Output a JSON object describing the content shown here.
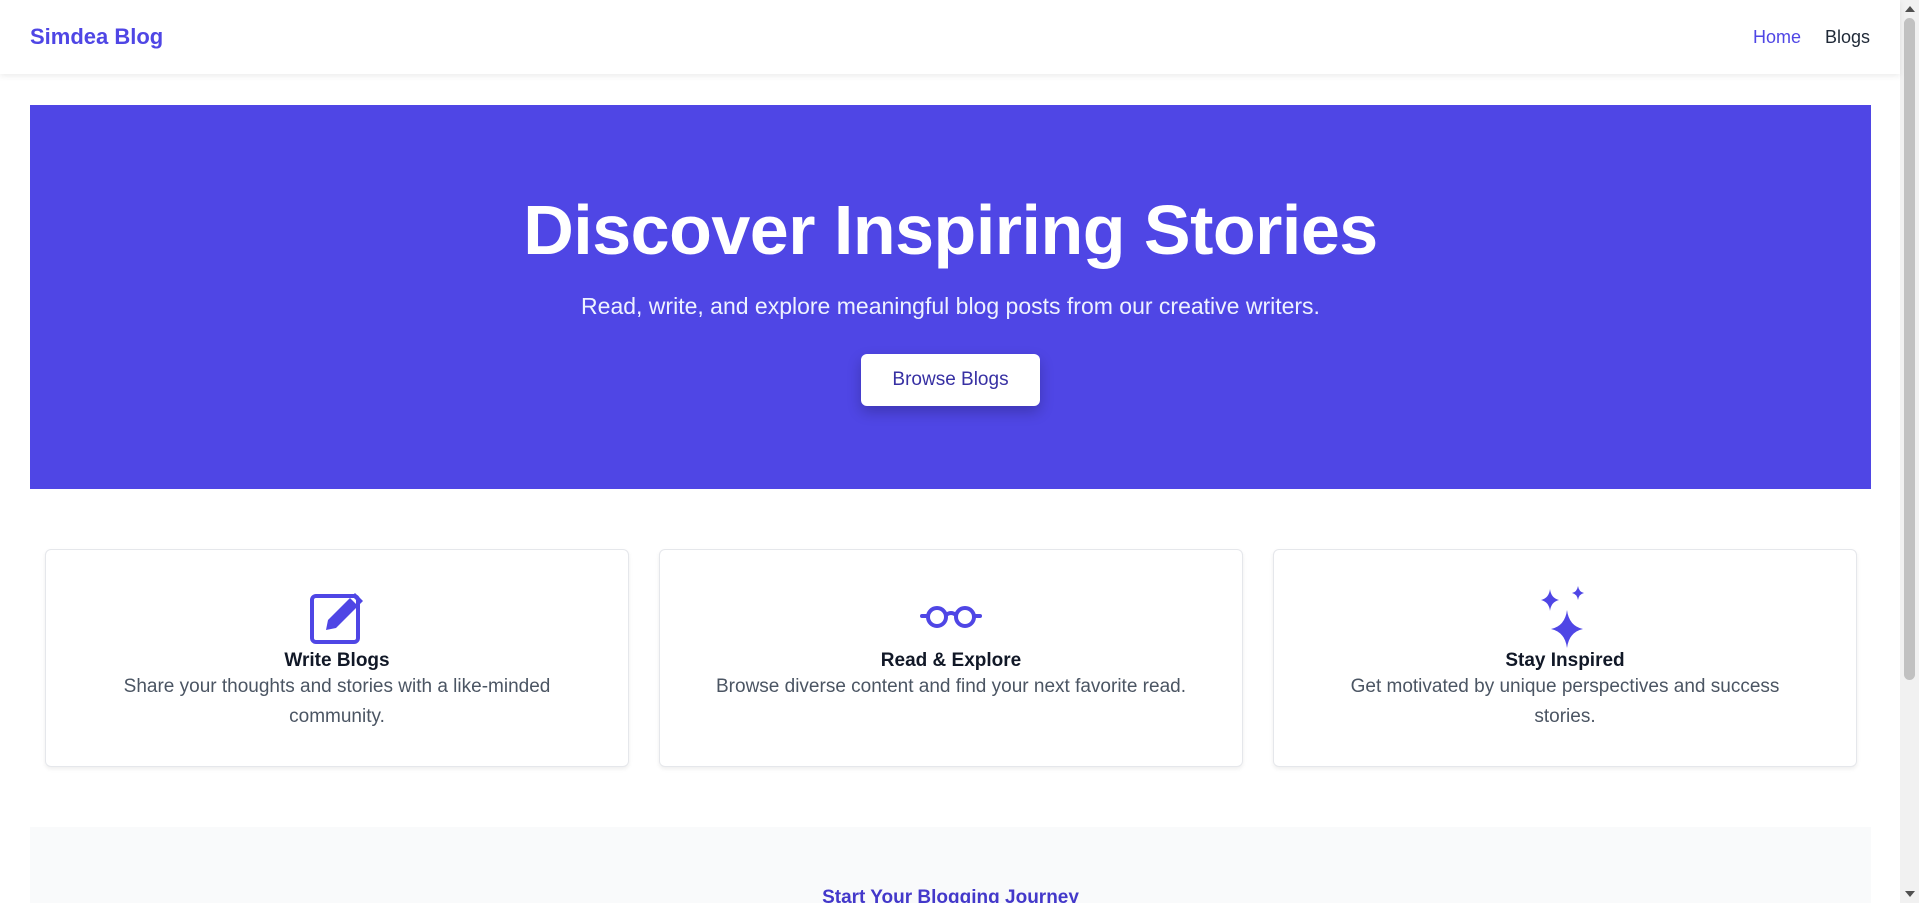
{
  "navbar": {
    "brand": "Simdea Blog",
    "links": [
      {
        "label": "Home",
        "active": true
      },
      {
        "label": "Blogs",
        "active": false
      }
    ]
  },
  "hero": {
    "title": "Discover Inspiring Stories",
    "subtitle": "Read, write, and explore meaningful blog posts from our creative writers.",
    "button_label": "Browse Blogs"
  },
  "features": [
    {
      "icon": "pencil-square-icon",
      "title": "Write Blogs",
      "description": "Share your thoughts and stories with a like-minded community."
    },
    {
      "icon": "glasses-icon",
      "title": "Read & Explore",
      "description": "Browse diverse content and find your next favorite read."
    },
    {
      "icon": "sparkles-icon",
      "title": "Stay Inspired",
      "description": "Get motivated by unique perspectives and success stories."
    }
  ],
  "journey": {
    "title": "Start Your Blogging Journey"
  },
  "colors": {
    "accent": "#4f46e5",
    "hero_bg": "#4f46e5",
    "button_text": "#3730a3"
  }
}
